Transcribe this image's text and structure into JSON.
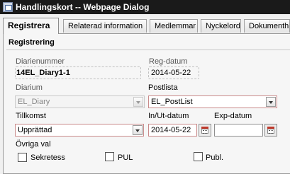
{
  "window": {
    "title": "Handlingskort -- Webpage Dialog"
  },
  "tabs": [
    {
      "label": "Registrera"
    },
    {
      "label": "Relaterad information"
    },
    {
      "label": "Medlemmar"
    },
    {
      "label": "Nyckelord"
    },
    {
      "label": "Dokumenthis"
    }
  ],
  "section": {
    "title": "Registrering"
  },
  "form": {
    "diarienummer": {
      "label": "Diarienummer",
      "value": "14EL_Diary1-1"
    },
    "reg_datum": {
      "label": "Reg-datum",
      "value": "2014-05-22"
    },
    "diarium": {
      "label": "Diarium",
      "value": "EL_Diary"
    },
    "postlista": {
      "label": "Postlista",
      "value": "EL_PostList"
    },
    "tillkomst": {
      "label": "Tillkomst",
      "value": "Upprättad"
    },
    "in_ut_datum": {
      "label": "In/Ut-datum",
      "value": "2014-05-22"
    },
    "exp_datum": {
      "label": "Exp-datum",
      "value": ""
    },
    "ovriga_val": {
      "label": "Övriga val",
      "options": [
        {
          "label": "Sekretess",
          "checked": false
        },
        {
          "label": "PUL",
          "checked": false
        },
        {
          "label": "Publ.",
          "checked": false
        }
      ]
    }
  }
}
